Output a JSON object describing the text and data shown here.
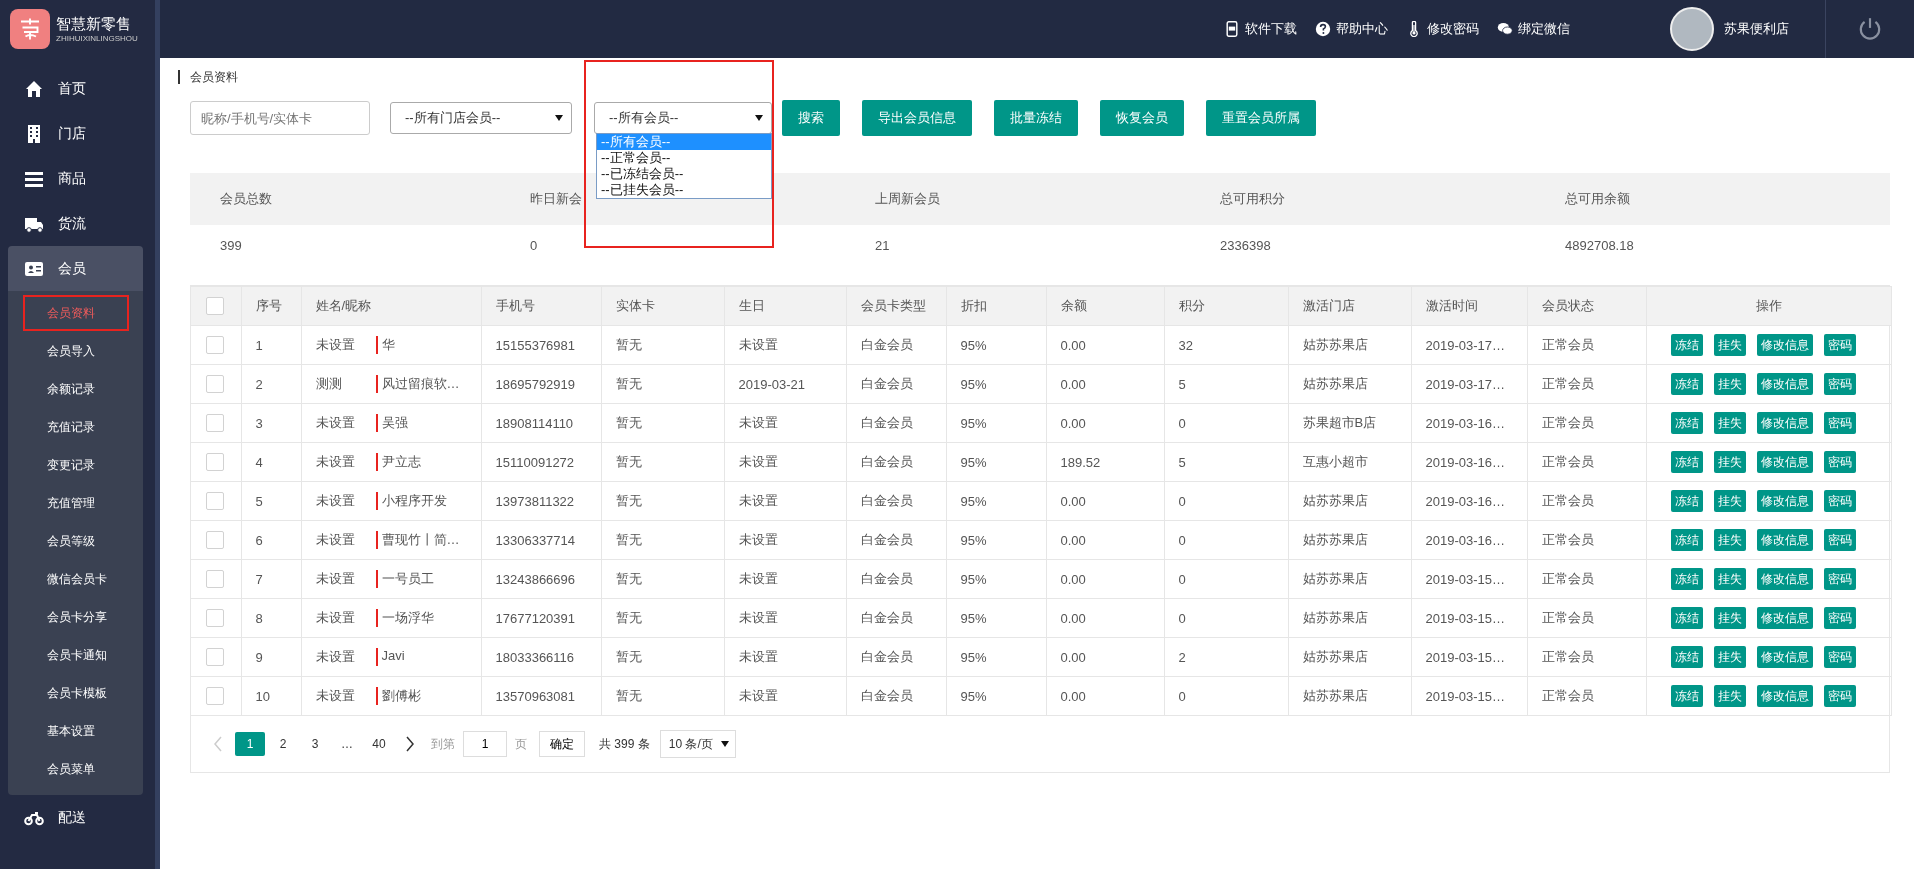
{
  "brand": {
    "name": "智慧新零售",
    "subtitle": "ZHIHUIXINLINGSHOU"
  },
  "sidebar": {
    "items": [
      {
        "label": "首页",
        "kind": "home",
        "selected": false
      },
      {
        "label": "门店",
        "kind": "building",
        "selected": false
      },
      {
        "label": "商品",
        "kind": "list",
        "selected": false
      },
      {
        "label": "货流",
        "kind": "truck",
        "selected": false
      },
      {
        "label": "会员",
        "kind": "card",
        "selected": true,
        "expanded": true,
        "children": [
          {
            "label": "会员资料",
            "selected": true,
            "outlined": true
          },
          {
            "label": "会员导入",
            "selected": false,
            "outlined": false
          },
          {
            "label": "余额记录",
            "selected": false,
            "outlined": false
          },
          {
            "label": "充值记录",
            "selected": false,
            "outlined": false
          },
          {
            "label": "变更记录",
            "selected": false,
            "outlined": false
          },
          {
            "label": "充值管理",
            "selected": false,
            "outlined": false
          },
          {
            "label": "会员等级",
            "selected": false,
            "outlined": false
          },
          {
            "label": "微信会员卡",
            "selected": false,
            "outlined": false
          },
          {
            "label": "会员卡分享",
            "selected": false,
            "outlined": false
          },
          {
            "label": "会员卡通知",
            "selected": false,
            "outlined": false
          },
          {
            "label": "会员卡模板",
            "selected": false,
            "outlined": false
          },
          {
            "label": "基本设置",
            "selected": false,
            "outlined": false
          },
          {
            "label": "会员菜单",
            "selected": false,
            "outlined": false
          }
        ]
      },
      {
        "label": "配送",
        "kind": "motorcycle",
        "selected": false
      }
    ]
  },
  "topbar": {
    "links": [
      {
        "label": "软件下载",
        "kind": "app"
      },
      {
        "label": "帮助中心",
        "kind": "help"
      },
      {
        "label": "修改密码",
        "kind": "thermometer"
      },
      {
        "label": "绑定微信",
        "kind": "chat"
      }
    ],
    "user": "苏果便利店"
  },
  "breadcrumb": "会员资料",
  "filters": {
    "search": {
      "placeholder": "昵称/手机号/实体卡"
    },
    "store_select": "--所有门店会员--",
    "status_select": {
      "value": "--所有会员--",
      "expanded": true,
      "outlined": true,
      "options": [
        {
          "label": "--所有会员--",
          "selected": true
        },
        {
          "label": "--正常会员--",
          "selected": false
        },
        {
          "label": "--已冻结会员--",
          "selected": false
        },
        {
          "label": "--已挂失会员--",
          "selected": false
        }
      ]
    },
    "buttons": [
      "搜索",
      "导出会员信息",
      "批量冻结",
      "恢复会员",
      "重置会员所属"
    ]
  },
  "stats": [
    {
      "label": "会员总数",
      "value": "399"
    },
    {
      "label": "昨日新会",
      "value": "0"
    },
    {
      "label": "上周新会员",
      "value": "21"
    },
    {
      "label": "总可用积分",
      "value": "2336398"
    },
    {
      "label": "总可用余额",
      "value": "4892708.18"
    }
  ],
  "table": {
    "select_all": {
      "checked": false
    },
    "columns": [
      "序号",
      "姓名/昵称",
      "手机号",
      "实体卡",
      "生日",
      "会员卡类型",
      "折扣",
      "余额",
      "积分",
      "激活门店",
      "激活时间",
      "会员状态",
      "操作"
    ],
    "rows": [
      {
        "checked": false,
        "cells": [
          "1",
          {
            "name": "未设置",
            "nickname": "华"
          },
          "15155376981",
          "暂无",
          "未设置",
          "白金会员",
          "95%",
          "0.00",
          "32",
          "姑苏苏果店",
          "2019-03-17…",
          "正常会员"
        ],
        "actions": [
          "冻结",
          "挂失",
          "修改信息",
          "密码"
        ]
      },
      {
        "checked": false,
        "cells": [
          "2",
          {
            "name": "测测",
            "nickname": "风过留痕软…"
          },
          "18695792919",
          "暂无",
          "2019-03-21",
          "白金会员",
          "95%",
          "0.00",
          "5",
          "姑苏苏果店",
          "2019-03-17…",
          "正常会员"
        ],
        "actions": [
          "冻结",
          "挂失",
          "修改信息",
          "密码"
        ]
      },
      {
        "checked": false,
        "cells": [
          "3",
          {
            "name": "未设置",
            "nickname": "吴强"
          },
          "18908114110",
          "暂无",
          "未设置",
          "白金会员",
          "95%",
          "0.00",
          "0",
          "苏果超市B店",
          "2019-03-16…",
          "正常会员"
        ],
        "actions": [
          "冻结",
          "挂失",
          "修改信息",
          "密码"
        ]
      },
      {
        "checked": false,
        "cells": [
          "4",
          {
            "name": "未设置",
            "nickname": "尹立志"
          },
          "15110091272",
          "暂无",
          "未设置",
          "白金会员",
          "95%",
          "189.52",
          "5",
          "互惠小超市",
          "2019-03-16…",
          "正常会员"
        ],
        "actions": [
          "冻结",
          "挂失",
          "修改信息",
          "密码"
        ]
      },
      {
        "checked": false,
        "cells": [
          "5",
          {
            "name": "未设置",
            "nickname": "小程序开发"
          },
          "13973811322",
          "暂无",
          "未设置",
          "白金会员",
          "95%",
          "0.00",
          "0",
          "姑苏苏果店",
          "2019-03-16…",
          "正常会员"
        ],
        "actions": [
          "冻结",
          "挂失",
          "修改信息",
          "密码"
        ]
      },
      {
        "checked": false,
        "cells": [
          "6",
          {
            "name": "未设置",
            "nickname": "曹现竹丨简…"
          },
          "13306337714",
          "暂无",
          "未设置",
          "白金会员",
          "95%",
          "0.00",
          "0",
          "姑苏苏果店",
          "2019-03-16…",
          "正常会员"
        ],
        "actions": [
          "冻结",
          "挂失",
          "修改信息",
          "密码"
        ]
      },
      {
        "checked": false,
        "cells": [
          "7",
          {
            "name": "未设置",
            "nickname": "一号员工"
          },
          "13243866696",
          "暂无",
          "未设置",
          "白金会员",
          "95%",
          "0.00",
          "0",
          "姑苏苏果店",
          "2019-03-15…",
          "正常会员"
        ],
        "actions": [
          "冻结",
          "挂失",
          "修改信息",
          "密码"
        ]
      },
      {
        "checked": false,
        "cells": [
          "8",
          {
            "name": "未设置",
            "nickname": "一场浮华"
          },
          "17677120391",
          "暂无",
          "未设置",
          "白金会员",
          "95%",
          "0.00",
          "0",
          "姑苏苏果店",
          "2019-03-15…",
          "正常会员"
        ],
        "actions": [
          "冻结",
          "挂失",
          "修改信息",
          "密码"
        ]
      },
      {
        "checked": false,
        "cells": [
          "9",
          {
            "name": "未设置",
            "nickname": "Javi"
          },
          "18033366116",
          "暂无",
          "未设置",
          "白金会员",
          "95%",
          "0.00",
          "2",
          "姑苏苏果店",
          "2019-03-15…",
          "正常会员"
        ],
        "actions": [
          "冻结",
          "挂失",
          "修改信息",
          "密码"
        ]
      },
      {
        "checked": false,
        "cells": [
          "10",
          {
            "name": "未设置",
            "nickname": "劉傅彬"
          },
          "13570963081",
          "暂无",
          "未设置",
          "白金会员",
          "95%",
          "0.00",
          "0",
          "姑苏苏果店",
          "2019-03-15…",
          "正常会员"
        ],
        "actions": [
          "冻结",
          "挂失",
          "修改信息",
          "密码"
        ]
      }
    ]
  },
  "pagination": {
    "pages": [
      {
        "label": "1",
        "selected": true
      },
      {
        "label": "2",
        "selected": false
      },
      {
        "label": "3",
        "selected": false
      },
      {
        "label": "…",
        "selected": false
      },
      {
        "label": "40",
        "selected": false
      }
    ],
    "goto_label": "到第",
    "page_input": "1",
    "page_unit": "页",
    "confirm": "确定",
    "total": "共 399 条",
    "page_size": "10 条/页"
  }
}
